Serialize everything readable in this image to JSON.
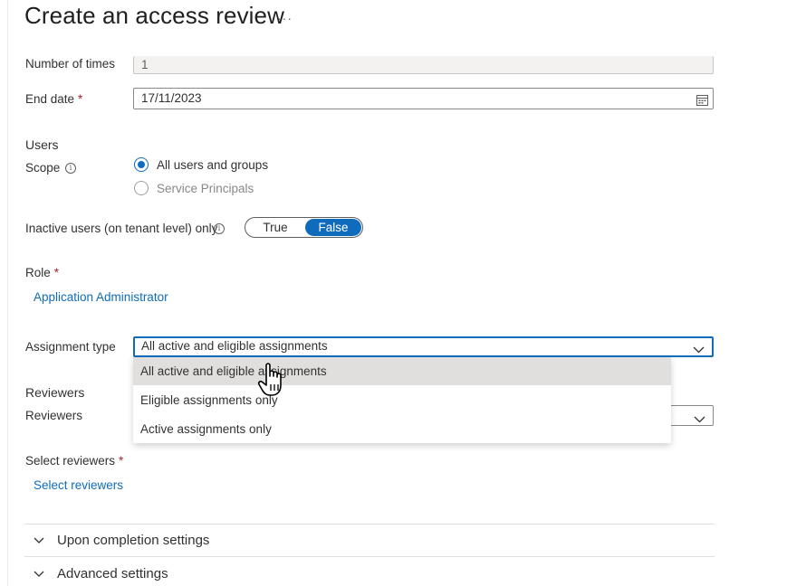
{
  "header": {
    "title": "Create an access review",
    "more_label": "···"
  },
  "form": {
    "number_of_times": {
      "label": "Number of times",
      "value": "1"
    },
    "end_date": {
      "label": "End date",
      "required": "*",
      "value": "17/11/2023"
    },
    "users_section": "Users",
    "scope": {
      "label": "Scope",
      "options": [
        {
          "label": "All users and groups",
          "selected": true
        },
        {
          "label": "Service Principals",
          "selected": false
        }
      ]
    },
    "inactive_users": {
      "label": "Inactive users (on tenant level) only",
      "true_label": "True",
      "false_label": "False",
      "value": "False"
    },
    "role": {
      "label": "Role",
      "required": "*",
      "link": "Application Administrator"
    },
    "assignment_type": {
      "label": "Assignment type",
      "value": "All active and eligible assignments",
      "options": [
        "All active and eligible assignments",
        "Eligible assignments only",
        "Active assignments only"
      ]
    },
    "reviewers_section": "Reviewers",
    "reviewers": {
      "label": "Reviewers"
    },
    "select_reviewers": {
      "label": "Select reviewers",
      "required": "*",
      "link": "Select reviewers"
    }
  },
  "sections": [
    {
      "label": "Upon completion settings"
    },
    {
      "label": "Advanced settings"
    }
  ],
  "colors": {
    "accent": "#0f6cbd",
    "required": "#a4262c",
    "menu_hover": "#e1dfdd"
  },
  "icons": [
    "more-icon",
    "calendar-icon",
    "info-icon",
    "chevron-down-icon",
    "hand-cursor-icon"
  ]
}
